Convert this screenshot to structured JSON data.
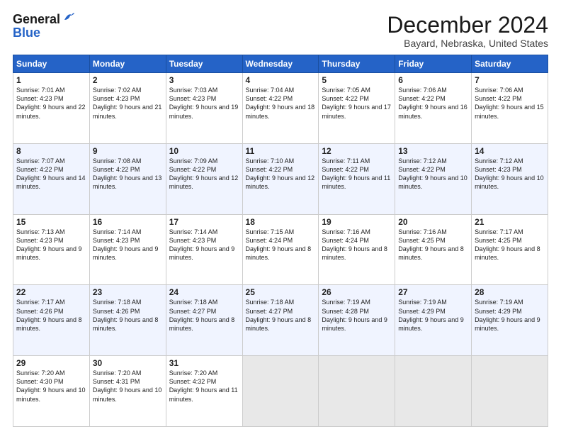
{
  "logo": {
    "line1": "General",
    "line2": "Blue"
  },
  "title": "December 2024",
  "subtitle": "Bayard, Nebraska, United States",
  "headers": [
    "Sunday",
    "Monday",
    "Tuesday",
    "Wednesday",
    "Thursday",
    "Friday",
    "Saturday"
  ],
  "weeks": [
    [
      {
        "day": "1",
        "sunrise": "7:01 AM",
        "sunset": "4:23 PM",
        "daylight": "9 hours and 22 minutes."
      },
      {
        "day": "2",
        "sunrise": "7:02 AM",
        "sunset": "4:23 PM",
        "daylight": "9 hours and 21 minutes."
      },
      {
        "day": "3",
        "sunrise": "7:03 AM",
        "sunset": "4:23 PM",
        "daylight": "9 hours and 19 minutes."
      },
      {
        "day": "4",
        "sunrise": "7:04 AM",
        "sunset": "4:22 PM",
        "daylight": "9 hours and 18 minutes."
      },
      {
        "day": "5",
        "sunrise": "7:05 AM",
        "sunset": "4:22 PM",
        "daylight": "9 hours and 17 minutes."
      },
      {
        "day": "6",
        "sunrise": "7:06 AM",
        "sunset": "4:22 PM",
        "daylight": "9 hours and 16 minutes."
      },
      {
        "day": "7",
        "sunrise": "7:06 AM",
        "sunset": "4:22 PM",
        "daylight": "9 hours and 15 minutes."
      }
    ],
    [
      {
        "day": "8",
        "sunrise": "7:07 AM",
        "sunset": "4:22 PM",
        "daylight": "9 hours and 14 minutes."
      },
      {
        "day": "9",
        "sunrise": "7:08 AM",
        "sunset": "4:22 PM",
        "daylight": "9 hours and 13 minutes."
      },
      {
        "day": "10",
        "sunrise": "7:09 AM",
        "sunset": "4:22 PM",
        "daylight": "9 hours and 12 minutes."
      },
      {
        "day": "11",
        "sunrise": "7:10 AM",
        "sunset": "4:22 PM",
        "daylight": "9 hours and 12 minutes."
      },
      {
        "day": "12",
        "sunrise": "7:11 AM",
        "sunset": "4:22 PM",
        "daylight": "9 hours and 11 minutes."
      },
      {
        "day": "13",
        "sunrise": "7:12 AM",
        "sunset": "4:22 PM",
        "daylight": "9 hours and 10 minutes."
      },
      {
        "day": "14",
        "sunrise": "7:12 AM",
        "sunset": "4:23 PM",
        "daylight": "9 hours and 10 minutes."
      }
    ],
    [
      {
        "day": "15",
        "sunrise": "7:13 AM",
        "sunset": "4:23 PM",
        "daylight": "9 hours and 9 minutes."
      },
      {
        "day": "16",
        "sunrise": "7:14 AM",
        "sunset": "4:23 PM",
        "daylight": "9 hours and 9 minutes."
      },
      {
        "day": "17",
        "sunrise": "7:14 AM",
        "sunset": "4:23 PM",
        "daylight": "9 hours and 9 minutes."
      },
      {
        "day": "18",
        "sunrise": "7:15 AM",
        "sunset": "4:24 PM",
        "daylight": "9 hours and 8 minutes."
      },
      {
        "day": "19",
        "sunrise": "7:16 AM",
        "sunset": "4:24 PM",
        "daylight": "9 hours and 8 minutes."
      },
      {
        "day": "20",
        "sunrise": "7:16 AM",
        "sunset": "4:25 PM",
        "daylight": "9 hours and 8 minutes."
      },
      {
        "day": "21",
        "sunrise": "7:17 AM",
        "sunset": "4:25 PM",
        "daylight": "9 hours and 8 minutes."
      }
    ],
    [
      {
        "day": "22",
        "sunrise": "7:17 AM",
        "sunset": "4:26 PM",
        "daylight": "9 hours and 8 minutes."
      },
      {
        "day": "23",
        "sunrise": "7:18 AM",
        "sunset": "4:26 PM",
        "daylight": "9 hours and 8 minutes."
      },
      {
        "day": "24",
        "sunrise": "7:18 AM",
        "sunset": "4:27 PM",
        "daylight": "9 hours and 8 minutes."
      },
      {
        "day": "25",
        "sunrise": "7:18 AM",
        "sunset": "4:27 PM",
        "daylight": "9 hours and 8 minutes."
      },
      {
        "day": "26",
        "sunrise": "7:19 AM",
        "sunset": "4:28 PM",
        "daylight": "9 hours and 9 minutes."
      },
      {
        "day": "27",
        "sunrise": "7:19 AM",
        "sunset": "4:29 PM",
        "daylight": "9 hours and 9 minutes."
      },
      {
        "day": "28",
        "sunrise": "7:19 AM",
        "sunset": "4:29 PM",
        "daylight": "9 hours and 9 minutes."
      }
    ],
    [
      {
        "day": "29",
        "sunrise": "7:20 AM",
        "sunset": "4:30 PM",
        "daylight": "9 hours and 10 minutes."
      },
      {
        "day": "30",
        "sunrise": "7:20 AM",
        "sunset": "4:31 PM",
        "daylight": "9 hours and 10 minutes."
      },
      {
        "day": "31",
        "sunrise": "7:20 AM",
        "sunset": "4:32 PM",
        "daylight": "9 hours and 11 minutes."
      },
      null,
      null,
      null,
      null
    ]
  ]
}
